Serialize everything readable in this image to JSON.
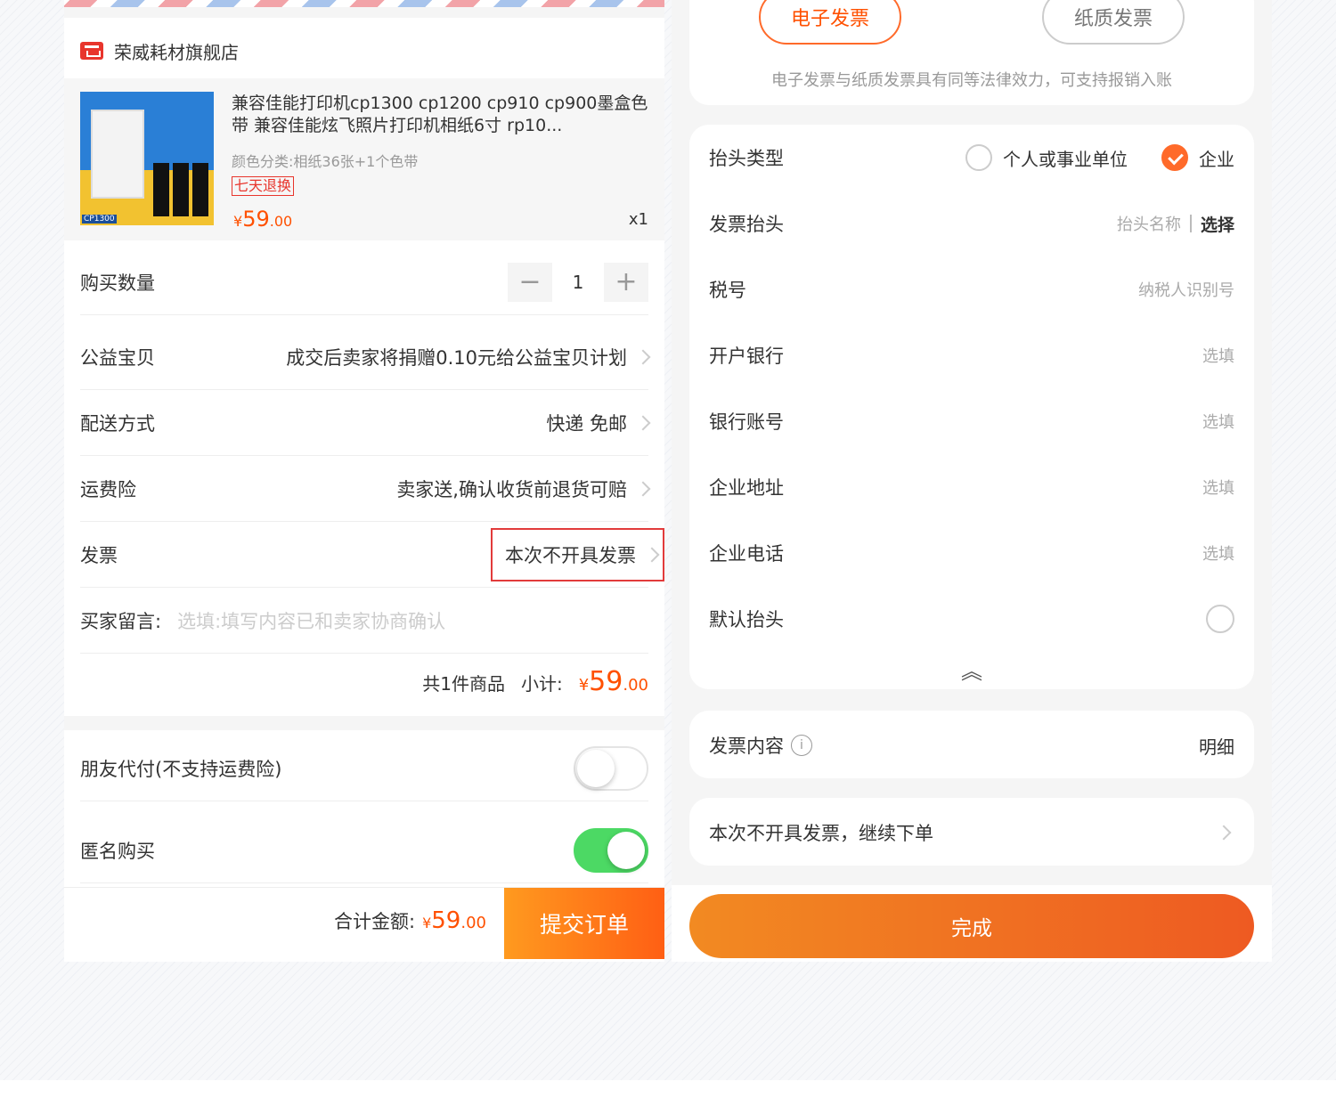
{
  "left": {
    "shop_name": "荣威耗材旗舰店",
    "product": {
      "title": "兼容佳能打印机cp1300 cp1200 cp910 cp900墨盒色带 兼容佳能炫飞照片打印机相纸6寸 rp10...",
      "sku": "颜色分类:相纸36张+1个色带",
      "return_tag": "七天退换",
      "price_symbol": "¥",
      "price_int": "59",
      "price_dec": ".00",
      "qty": "x1",
      "thumb_label": "CP1300"
    },
    "quantity": {
      "label": "购买数量",
      "minus": "−",
      "value": "1",
      "plus": "+"
    },
    "charity": {
      "label": "公益宝贝",
      "value": "成交后卖家将捐赠0.10元给公益宝贝计划"
    },
    "delivery": {
      "label": "配送方式",
      "value": "快递 免邮"
    },
    "insurance": {
      "label": "运费险",
      "value": "卖家送,确认收货前退货可赔"
    },
    "invoice": {
      "label": "发票",
      "value": "本次不开具发票"
    },
    "message": {
      "label": "买家留言:",
      "placeholder": "选填:填写内容已和卖家协商确认"
    },
    "subtotal": {
      "count": "共1件商品",
      "label": "小计:",
      "symbol": "¥",
      "int": "59",
      "dec": ".00"
    },
    "friend_pay": {
      "label": "朋友代付(不支持运费险)",
      "on": false
    },
    "anonymous": {
      "label": "匿名购买",
      "on": true
    },
    "footer": {
      "total_label": "合计金额:",
      "symbol": "¥",
      "int": "59",
      "dec": ".00",
      "submit": "提交订单"
    }
  },
  "right": {
    "type_electronic": "电子发票",
    "type_paper": "纸质发票",
    "type_note": "电子发票与纸质发票具有同等法律效力，可支持报销入账",
    "header_type": {
      "label": "抬头类型",
      "opt_personal": "个人或事业单位",
      "opt_company": "企业",
      "selected": "企业"
    },
    "header_title": {
      "label": "发票抬头",
      "placeholder": "抬头名称",
      "choose": "选择"
    },
    "tax_no": {
      "label": "税号",
      "placeholder": "纳税人识别号"
    },
    "bank": {
      "label": "开户银行",
      "placeholder": "选填"
    },
    "account": {
      "label": "银行账号",
      "placeholder": "选填"
    },
    "address": {
      "label": "企业地址",
      "placeholder": "选填"
    },
    "phone": {
      "label": "企业电话",
      "placeholder": "选填"
    },
    "default_header": {
      "label": "默认抬头"
    },
    "collapse_glyph": "︽",
    "content": {
      "label": "发票内容",
      "value": "明细"
    },
    "no_invoice": {
      "label": "本次不开具发票，继续下单"
    },
    "done": "完成"
  },
  "colors": {
    "accent": "#ff5000",
    "toggle_on": "#4cd964",
    "highlight_box": "#e23b3b"
  }
}
